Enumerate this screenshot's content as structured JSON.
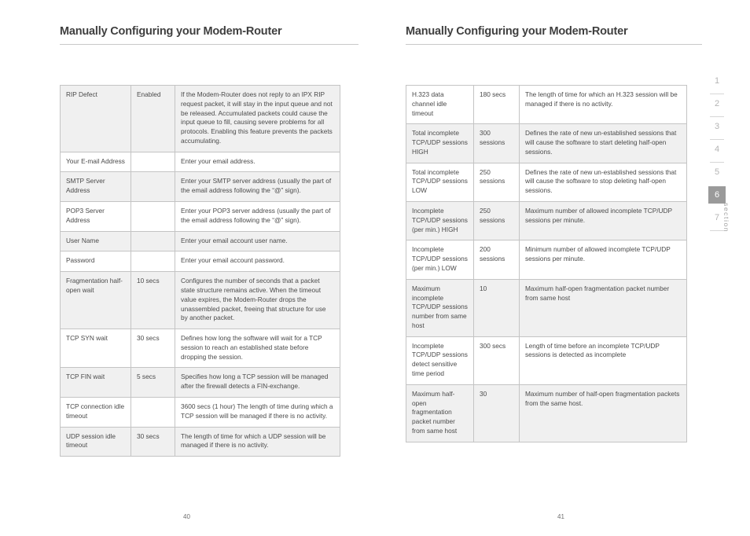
{
  "left_page": {
    "title": "Manually Configuring your Modem-Router",
    "page_number": "40",
    "table": {
      "rows": [
        {
          "shaded": true,
          "name": "RIP Defect",
          "value": "Enabled",
          "description": "If the Modem-Router does not reply to an IPX RIP request packet, it will stay in the input queue and not be released. Accumulated packets could cause the input queue to fill, causing severe problems for all protocols. Enabling this feature prevents the packets accumulating."
        },
        {
          "shaded": false,
          "name": "Your E-mail Address",
          "value": "",
          "description": "Enter your email address."
        },
        {
          "shaded": true,
          "name": "SMTP Server Address",
          "value": "",
          "description": "Enter your SMTP server address (usually the part of the email address following the “@” sign)."
        },
        {
          "shaded": false,
          "name": "POP3 Server Address",
          "value": "",
          "description": "Enter your POP3 server address (usually the part of the email address following the “@” sign)."
        },
        {
          "shaded": true,
          "name": "User Name",
          "value": "",
          "description": "Enter your email account user name."
        },
        {
          "shaded": false,
          "name": "Password",
          "value": "",
          "description": "Enter your email account password."
        },
        {
          "shaded": true,
          "name": "Fragmentation half-open wait",
          "value": "10 secs",
          "description": "Configures the number of seconds that a packet state structure remains active. When the timeout value expires, the Modem-Router drops the unassembled packet, freeing that structure for use by another packet."
        },
        {
          "shaded": false,
          "name": "TCP SYN wait",
          "value": "30 secs",
          "description": "Defines how long the software will wait for a TCP session to reach an established state before dropping the session."
        },
        {
          "shaded": true,
          "name": "TCP FIN wait",
          "value": "5 secs",
          "description": "Specifies how long a TCP session will be managed after the firewall detects a FIN-exchange."
        },
        {
          "shaded": false,
          "name": "TCP connection idle timeout",
          "value": "",
          "description": "3600 secs (1 hour) The length of time during which a TCP session will be managed if there is no activity."
        },
        {
          "shaded": true,
          "name": "UDP session idle timeout",
          "value": "30 secs",
          "description": "The length of time for which a UDP session will be managed if there is no activity."
        }
      ]
    }
  },
  "right_page": {
    "title": "Manually Configuring your Modem-Router",
    "page_number": "41",
    "table": {
      "rows": [
        {
          "shaded": false,
          "name": "H.323 data channel idle timeout",
          "value": "180 secs",
          "description": "The length of time for which an H.323 session will be managed if there is no activity."
        },
        {
          "shaded": true,
          "name": "Total incomplete TCP/UDP sessions HIGH",
          "value": "300 sessions",
          "description": "Defines the rate of new un-established sessions that will cause the software to start deleting half-open sessions."
        },
        {
          "shaded": false,
          "name": "Total incomplete TCP/UDP sessions LOW",
          "value": "250 sessions",
          "description": "Defines the rate of new un-established sessions that will cause the software to stop deleting half-open sessions."
        },
        {
          "shaded": true,
          "name": "Incomplete TCP/UDP sessions (per min.) HIGH",
          "value": "250 sessions",
          "description": "Maximum number of allowed incomplete TCP/UDP sessions per minute."
        },
        {
          "shaded": false,
          "name": "Incomplete TCP/UDP sessions (per min.) LOW",
          "value": "200 sessions",
          "description": "Minimum number of allowed incomplete TCP/UDP sessions per minute."
        },
        {
          "shaded": true,
          "name": "Maximum incomplete TCP/UDP sessions number from same host",
          "value": "10",
          "description": "Maximum half-open fragmentation packet number from same host"
        },
        {
          "shaded": false,
          "name": "Incomplete TCP/UDP sessions detect sensitive time period",
          "value": "300 secs",
          "description": "Length of time before an incomplete TCP/UDP sessions is detected as incomplete"
        },
        {
          "shaded": true,
          "name": "Maximum half-open fragmentation packet number from same host",
          "value": "30",
          "description": "Maximum number of half-open fragmentation packets from the same host."
        }
      ]
    }
  },
  "section_rail": {
    "label": "section",
    "items": [
      {
        "number": "1",
        "active": false
      },
      {
        "number": "2",
        "active": false
      },
      {
        "number": "3",
        "active": false
      },
      {
        "number": "4",
        "active": false
      },
      {
        "number": "5",
        "active": false
      },
      {
        "number": "6",
        "active": true
      },
      {
        "number": "7",
        "active": false
      }
    ]
  }
}
